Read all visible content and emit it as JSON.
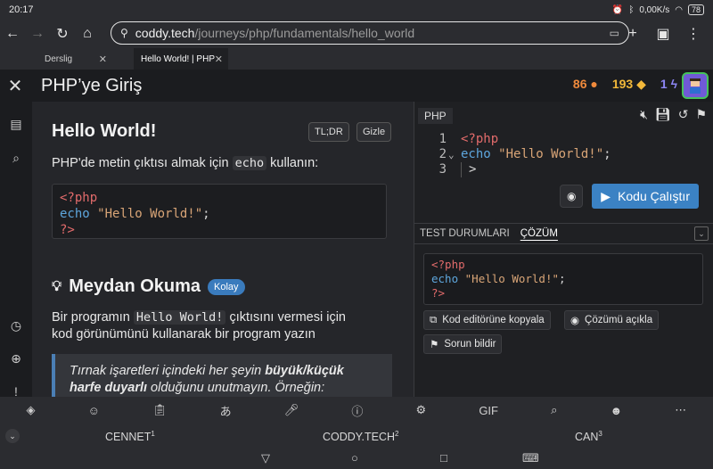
{
  "status": {
    "time": "20:17",
    "speed": "0,00K/s",
    "battery": "78"
  },
  "browser": {
    "url_host": "coddy.tech",
    "url_path": "/journeys/php/fundamentals/hello_world",
    "tabs": [
      {
        "label": "Derslig"
      },
      {
        "label": "Hello World! | PHP"
      }
    ]
  },
  "app": {
    "title": "PHP’ye Giriş",
    "stats": {
      "streak": "86",
      "gems": "193",
      "energy": "1"
    }
  },
  "lesson": {
    "title": "Hello World!",
    "tldr_label": "TL;DR",
    "hide_label": "Gizle",
    "intro_before": "PHP'de metin çıktısı almak için",
    "intro_code": "echo",
    "intro_after": "kullanın:",
    "code": {
      "line1": "<?php",
      "kw": "echo",
      "str": "\"Hello World!\"",
      "semi": ";",
      "close": "?>"
    },
    "challenge_title": "Meydan Okuma",
    "difficulty": "Kolay",
    "challenge_before": "Bir programın",
    "challenge_code": "Hello World!",
    "challenge_after": "çıktısını vermesi için",
    "challenge_line2": "kod görünümünü kullanarak bir program yazın",
    "note_line1_a": "Tırnak işaretleri içindeki her şeyin ",
    "note_line1_b": "büyük/küçük",
    "note_line2_a": "harfe duyarlı",
    "note_line2_b": " olduğunu unutmayın. Örneğin:"
  },
  "editor": {
    "language": "PHP",
    "lines": [
      {
        "n": "1",
        "text": "<?php"
      },
      {
        "n": "2",
        "kw": "echo",
        "str": "\"Hello World!\"",
        "semi": ";"
      },
      {
        "n": "3",
        "text": ">"
      }
    ],
    "run_label": "Kodu Çalıştır",
    "tab_tests": "TEST DURUMLARI",
    "tab_solution": "ÇÖZÜM",
    "solution": {
      "line1": "<?php",
      "kw": "echo",
      "str": "\"Hello World!\"",
      "semi": ";",
      "close": "?>"
    },
    "copy_label": "Kod editörüne kopyala",
    "explain_label": "Çözümü açıkla",
    "report_label": "Sorun bildir"
  },
  "keyboard": {
    "suggestions": [
      {
        "word": "CENNET",
        "n": "1"
      },
      {
        "word": "CODDY.TECH",
        "n": "2"
      },
      {
        "word": "CAN",
        "n": "3"
      }
    ]
  }
}
